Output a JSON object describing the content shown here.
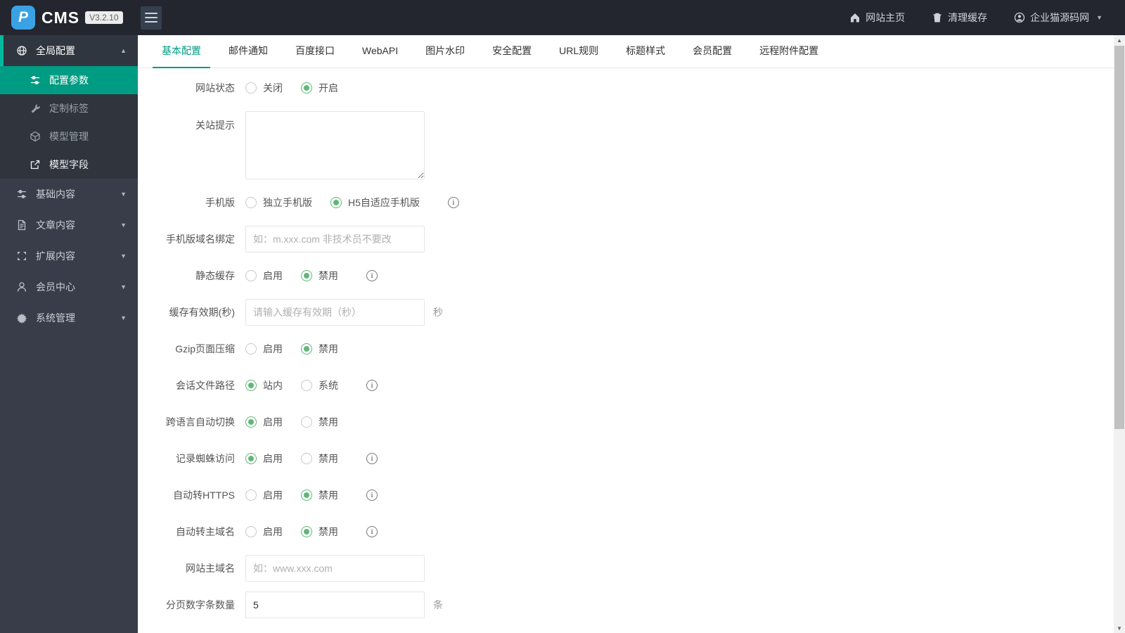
{
  "colors": {
    "accent": "#009B83",
    "accent_bright": "#00BA9D",
    "radio_green": "#5FB878",
    "header_bg": "#23262E",
    "sidebar_bg": "#393D49",
    "sidebar_group_bg": "#30363F",
    "sidebar_sub_bg": "#2F343D",
    "logo_blue": "#3AA2E4"
  },
  "header": {
    "logo_letter": "P",
    "logo_text": "CMS",
    "version": "V3.2.10",
    "links": [
      {
        "label": "网站主页",
        "icon": "home-icon"
      },
      {
        "label": "清理缓存",
        "icon": "trash-icon"
      },
      {
        "label": "企业猫源码网",
        "icon": "user-circle-icon",
        "caret": true
      }
    ]
  },
  "sidebar": {
    "items": [
      {
        "label": "全局配置",
        "icon": "globe-icon",
        "expanded": true,
        "children": [
          {
            "label": "配置参数",
            "icon": "sliders-icon",
            "active": true
          },
          {
            "label": "定制标签",
            "icon": "wrench-icon"
          },
          {
            "label": "模型管理",
            "icon": "cube-icon"
          },
          {
            "label": "模型字段",
            "icon": "external-link-icon",
            "bright": true
          }
        ]
      },
      {
        "label": "基础内容",
        "icon": "sliders-icon",
        "expanded": false
      },
      {
        "label": "文章内容",
        "icon": "document-icon",
        "expanded": false
      },
      {
        "label": "扩展内容",
        "icon": "expand-icon",
        "expanded": false
      },
      {
        "label": "会员中心",
        "icon": "user-icon",
        "expanded": false
      },
      {
        "label": "系统管理",
        "icon": "gear-icon",
        "expanded": false
      }
    ]
  },
  "tabs": {
    "active_index": 0,
    "items": [
      "基本配置",
      "邮件通知",
      "百度接口",
      "WebAPI",
      "图片水印",
      "安全配置",
      "URL规则",
      "标题样式",
      "会员配置",
      "远程附件配置"
    ]
  },
  "form": {
    "rows": [
      {
        "type": "radio",
        "label": "网站状态",
        "options": [
          {
            "label": "关闭",
            "checked": false
          },
          {
            "label": "开启",
            "checked": true
          }
        ],
        "info": false
      },
      {
        "type": "textarea",
        "label": "关站提示",
        "value": ""
      },
      {
        "type": "radio",
        "label": "手机版",
        "options": [
          {
            "label": "独立手机版",
            "checked": false
          },
          {
            "label": "H5自适应手机版",
            "checked": true
          }
        ],
        "info": true
      },
      {
        "type": "input",
        "label": "手机版域名绑定",
        "value": "",
        "placeholder": "如：m.xxx.com 非技术员不要改",
        "suffix": ""
      },
      {
        "type": "radio",
        "label": "静态缓存",
        "options": [
          {
            "label": "启用",
            "checked": false
          },
          {
            "label": "禁用",
            "checked": true
          }
        ],
        "info": true
      },
      {
        "type": "input",
        "label": "缓存有效期(秒)",
        "value": "",
        "placeholder": "请输入缓存有效期（秒）",
        "suffix": "秒"
      },
      {
        "type": "radio",
        "label": "Gzip页面压缩",
        "options": [
          {
            "label": "启用",
            "checked": false
          },
          {
            "label": "禁用",
            "checked": true
          }
        ],
        "info": false
      },
      {
        "type": "radio",
        "label": "会话文件路径",
        "options": [
          {
            "label": "站内",
            "checked": true
          },
          {
            "label": "系统",
            "checked": false
          }
        ],
        "info": true
      },
      {
        "type": "radio",
        "label": "跨语言自动切换",
        "options": [
          {
            "label": "启用",
            "checked": true
          },
          {
            "label": "禁用",
            "checked": false
          }
        ],
        "info": false
      },
      {
        "type": "radio",
        "label": "记录蜘蛛访问",
        "options": [
          {
            "label": "启用",
            "checked": true
          },
          {
            "label": "禁用",
            "checked": false
          }
        ],
        "info": true
      },
      {
        "type": "radio",
        "label": "自动转HTTPS",
        "options": [
          {
            "label": "启用",
            "checked": false
          },
          {
            "label": "禁用",
            "checked": true
          }
        ],
        "info": true
      },
      {
        "type": "radio",
        "label": "自动转主域名",
        "options": [
          {
            "label": "启用",
            "checked": false
          },
          {
            "label": "禁用",
            "checked": true
          }
        ],
        "info": true
      },
      {
        "type": "input",
        "label": "网站主域名",
        "value": "",
        "placeholder": "如：www.xxx.com",
        "suffix": ""
      },
      {
        "type": "input",
        "label": "分页数字条数量",
        "value": "5",
        "placeholder": "",
        "suffix": "条"
      }
    ]
  },
  "scrollbar": {
    "up_glyph": "▲",
    "down_glyph": "▼"
  }
}
